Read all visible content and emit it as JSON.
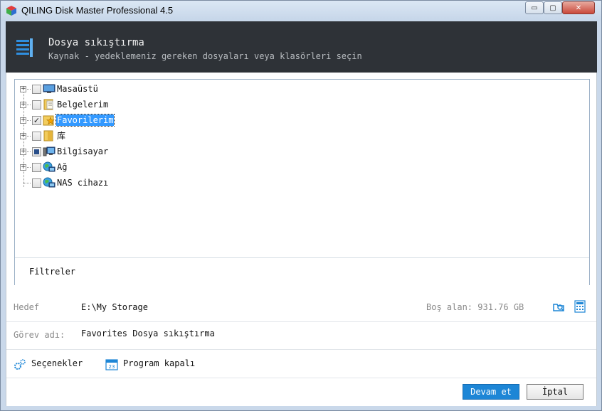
{
  "window": {
    "title": "QILING Disk Master Professional 4.5",
    "controls": {
      "minimize": "▭",
      "maximize": "▢",
      "close": "✕"
    }
  },
  "header": {
    "title": "Dosya sıkıştırma",
    "subtitle": "Kaynak - yedeklemeniz gereken dosyaları veya klasörleri seçin",
    "icon": "compress-icon"
  },
  "tree": {
    "items": [
      {
        "label": "Masaüstü",
        "icon": "desktop-icon",
        "checked": "none",
        "expandable": true
      },
      {
        "label": "Belgelerim",
        "icon": "documents-folder-icon",
        "checked": "none",
        "expandable": true
      },
      {
        "label": "Favorilerim",
        "icon": "favorites-folder-icon",
        "checked": "check",
        "expandable": true,
        "selected": true
      },
      {
        "label": "库",
        "icon": "library-folder-icon",
        "checked": "none",
        "expandable": true
      },
      {
        "label": "Bilgisayar",
        "icon": "computer-icon",
        "checked": "partial",
        "expandable": true
      },
      {
        "label": "Ağ",
        "icon": "network-icon",
        "checked": "none",
        "expandable": true
      },
      {
        "label": "NAS cihazı",
        "icon": "nas-device-icon",
        "checked": "none",
        "expandable": false
      }
    ],
    "check_mark": "✓",
    "expander_symbol": "+"
  },
  "filters": {
    "label": "Filtreler"
  },
  "destination": {
    "label": "Hedef",
    "value": "E:\\My Storage",
    "free_space": "Boş alan: 931.76 GB"
  },
  "task": {
    "label": "Görev adı:",
    "value": "Favorites Dosya sıkıştırma"
  },
  "options": {
    "settings_label": "Seçenekler",
    "schedule_label": "Program kapalı"
  },
  "buttons": {
    "next": "Devam et",
    "cancel": "İptal"
  },
  "colors": {
    "header_bg": "#2e3237",
    "accent": "#1d86d6",
    "selection": "#3399ff"
  }
}
